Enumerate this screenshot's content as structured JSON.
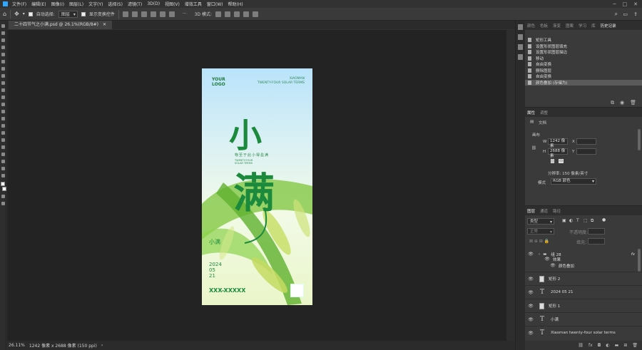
{
  "menu": [
    "文件(F)",
    "编辑(E)",
    "图像(I)",
    "图层(L)",
    "文字(Y)",
    "选择(S)",
    "滤镜(T)",
    "3D(D)",
    "视图(V)",
    "增效工具",
    "窗口(W)",
    "帮助(H)"
  ],
  "options": {
    "auto_select_label": "自动选择:",
    "auto_select_value": "图层",
    "show_transform_label": "显示变换控件",
    "mode_3d_label": "3D 模式:",
    "more": "···"
  },
  "doc_tab": "二十四节气之小满.psd @ 26.1%(RGB/8#)",
  "poster": {
    "your": "YOUR",
    "logo": "LOGO",
    "xiaoman": "XIAOMAN",
    "solar": "TWENTY-FOUR SOLAR TERMS",
    "big1": "小",
    "big2": "满",
    "sub_cn": "物至于此小得盈满",
    "sub_en1": "TWENTY-FOUR",
    "sub_en2": "SOLAR TERMS",
    "xm_v": "小满",
    "date1": "2024",
    "date2": "05",
    "date3": "21",
    "phone": "XXX-XXXXX"
  },
  "status": {
    "zoom": "26.11%",
    "info": "1242 像素 x 2688 像素 (150 ppi)",
    "arrow": "›"
  },
  "panel_tabs": [
    "颜色",
    "色板",
    "渐变",
    "图案",
    "学习",
    "库",
    "历史记录"
  ],
  "history": [
    "矩形工具",
    "设置形状图层填充",
    "设置形状图层描边",
    "移动",
    "自由变换",
    "删除图层",
    "自由变换",
    "颜色叠加 (存储为)"
  ],
  "props": {
    "tabs": [
      "属性",
      "调整"
    ],
    "doc_label": "文档",
    "canvas_label": "画布",
    "w_label": "W",
    "w_value": "1242 像素",
    "x_label": "X",
    "h_label": "H",
    "h_value": "2688 像素",
    "y_label": "Y",
    "res": "分辨率: 150 像素/英寸",
    "mode_label": "模式",
    "mode_value": "RGB 颜色"
  },
  "layers": {
    "tabs": [
      "图层",
      "通道",
      "路径"
    ],
    "kind": "类型",
    "blend": "正常",
    "opacity_label": "不透明度:",
    "fill_label": "填充:",
    "fx": "fx",
    "items": [
      {
        "type": "group",
        "name": "组 28"
      },
      {
        "type": "sub",
        "name": "效果"
      },
      {
        "type": "sub2",
        "name": "颜色叠加"
      },
      {
        "type": "shape",
        "name": "矩形 2"
      },
      {
        "type": "text",
        "name": "2024 05 21"
      },
      {
        "type": "shape",
        "name": "矩形 1"
      },
      {
        "type": "text",
        "name": "小满"
      },
      {
        "type": "text",
        "name": "Xiaoman twenty-four solar terms"
      }
    ]
  }
}
